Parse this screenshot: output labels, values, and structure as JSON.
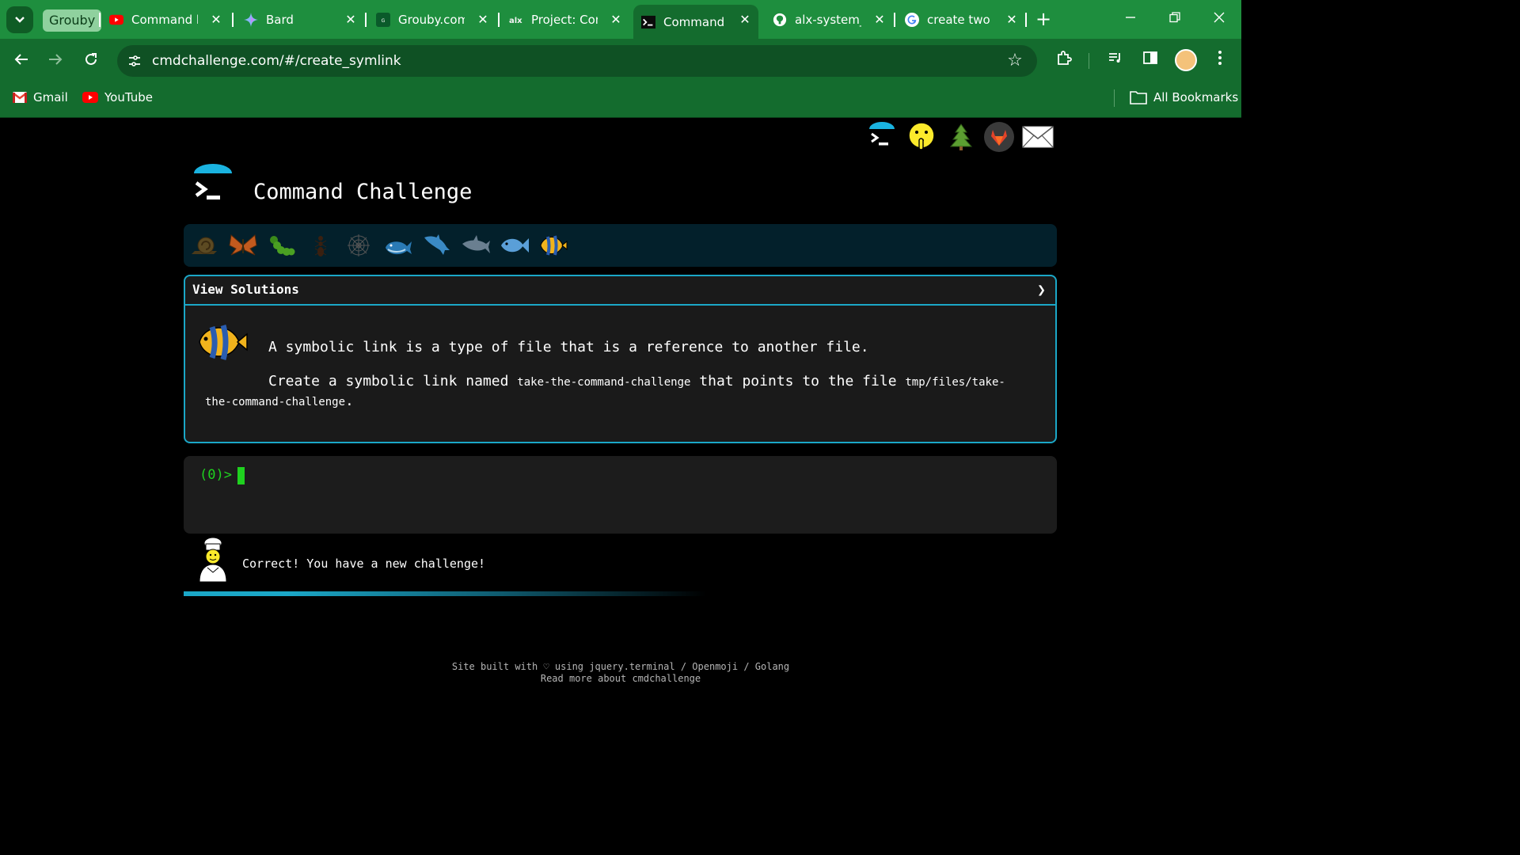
{
  "browser": {
    "tab_group": "Grouby",
    "tabs": [
      {
        "title": "Command li",
        "icon": "youtube-icon"
      },
      {
        "title": "Bard",
        "icon": "bard-sparkle-icon"
      },
      {
        "title": "Grouby.com",
        "icon": "grouby-icon"
      },
      {
        "title": "Project: Con",
        "icon": "alx-icon"
      },
      {
        "title": "Command C",
        "icon": "terminal-icon"
      },
      {
        "title": "alx-system_e",
        "icon": "github-icon"
      },
      {
        "title": "create two n",
        "icon": "google-icon"
      }
    ],
    "url": "cmdchallenge.com/#/create_symlink",
    "bookmarks": [
      {
        "label": "Gmail",
        "icon": "gmail-icon"
      },
      {
        "label": "YouTube",
        "icon": "youtube-icon"
      }
    ],
    "all_bookmarks": "All Bookmarks",
    "colors": {
      "frame": "#1e8e3e",
      "toolbar": "#146c2e"
    }
  },
  "site": {
    "title": "Command Challenge",
    "social_icons": [
      "terminal-logo-icon",
      "shushing-face-icon",
      "tree-icon",
      "gitlab-icon",
      "envelope-icon"
    ],
    "levels": [
      "snail-icon",
      "butterfly-icon",
      "caterpillar-icon",
      "ant-icon",
      "spiderweb-icon",
      "whale-icon",
      "dolphin-icon",
      "dolphin-grey-icon",
      "fish-icon",
      "tropical-fish-icon"
    ],
    "view_solutions": "View Solutions",
    "challenge": {
      "line1": "A symbolic link is a type of file that is a reference to another file.",
      "line2_a": "Create a symbolic link named",
      "link_name": "take-the-command-challenge",
      "line2_b": "that points to the file",
      "target": "tmp/files/take-the-command-challenge",
      "line2_end": "."
    },
    "prompt": "(0)>",
    "message": "Correct! You have a new challenge!",
    "footer_line1": "Site built with ♡ using jquery.terminal / Openmoji / Golang",
    "footer_line2": "Read more about cmdchallenge",
    "accent": "#1ba7c7",
    "prompt_color": "#1fd11f"
  }
}
